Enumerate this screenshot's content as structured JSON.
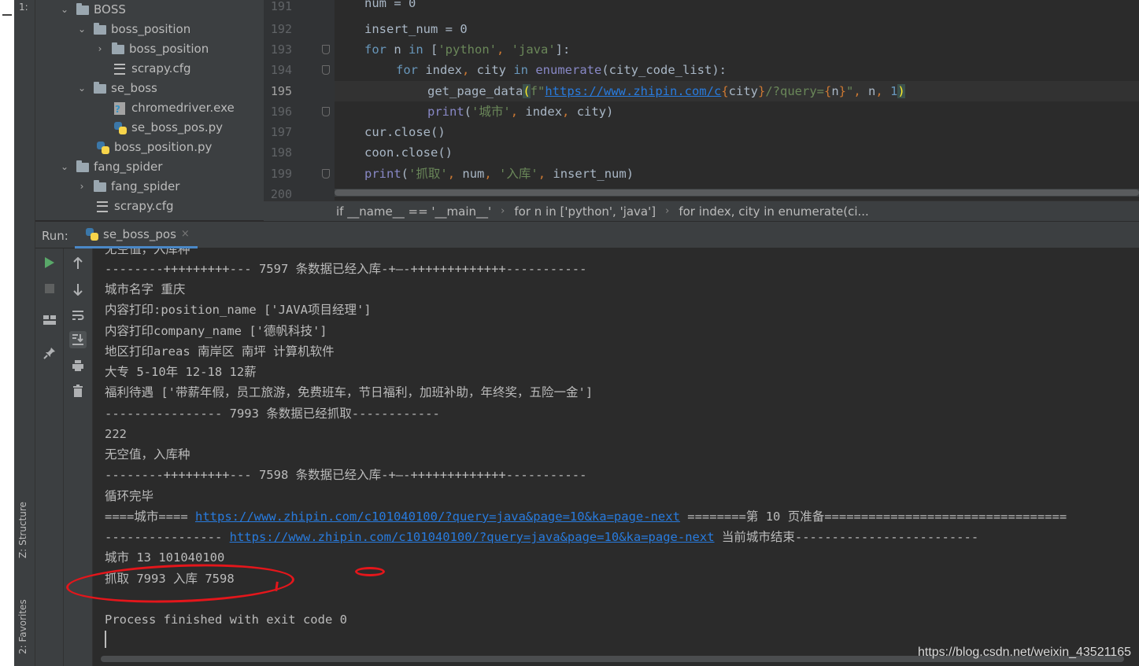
{
  "tool_stripe": {
    "top_item": "1:",
    "structure_tab": "Z: Structure",
    "favorites_tab": "2: Favorites"
  },
  "project_tree": {
    "items": [
      {
        "label": "BOSS",
        "type": "folder",
        "expanded": true
      },
      {
        "label": "boss_position",
        "type": "folder",
        "expanded": true
      },
      {
        "label": "boss_position",
        "type": "folder",
        "expanded": false
      },
      {
        "label": "scrapy.cfg",
        "type": "cfg"
      },
      {
        "label": "se_boss",
        "type": "folder",
        "expanded": true
      },
      {
        "label": "chromedriver.exe",
        "type": "exe"
      },
      {
        "label": "se_boss_pos.py",
        "type": "py"
      },
      {
        "label": "boss_position.py",
        "type": "py"
      },
      {
        "label": "fang_spider",
        "type": "folder",
        "expanded": true
      },
      {
        "label": "fang_spider",
        "type": "folder",
        "expanded": false
      },
      {
        "label": "scrapy.cfg",
        "type": "cfg"
      }
    ]
  },
  "editor": {
    "line_numbers": [
      "191",
      "192",
      "193",
      "194",
      "195",
      "196",
      "197",
      "198",
      "199",
      "200"
    ],
    "current_line": "195",
    "lines": {
      "l191": "num = 0",
      "l192": "insert_num = 0",
      "l193_for": "for",
      "l193_n": " n ",
      "l193_in": "in",
      "l193_list_open": " [",
      "l193_s1": "'python'",
      "l193_comma": ", ",
      "l193_s2": "'java'",
      "l193_close": "]:",
      "l194_for": "for",
      "l194_vars": " index",
      "l194_c": ",",
      "l194_city": " city ",
      "l194_in": "in",
      "l194_enum": " enumerate",
      "l194_rest": "(city_code_list):",
      "l195_fn": "get_page_data",
      "l195_paren": "(",
      "l195_f": "f\"",
      "l195_url": "https://www.zhipin.com/c",
      "l195_b1": "{",
      "l195_city": "city",
      "l195_b2": "}",
      "l195_mid": "/?query=",
      "l195_b3": "{",
      "l195_n": "n",
      "l195_b4": "}",
      "l195_q": "\"",
      "l195_c1": ",",
      "l195_narg": " n",
      "l195_c2": ",",
      "l195_one": " 1",
      "l195_end": ")",
      "l196_print": "print",
      "l196_open": "(",
      "l196_s": "'城市'",
      "l196_c1": ",",
      "l196_index": " index",
      "l196_c2": ",",
      "l196_rest": " city)",
      "l197": "cur.close()",
      "l198": "coon.close()",
      "l199_print": "print",
      "l199_open": "(",
      "l199_s1": "'抓取'",
      "l199_c1": ",",
      "l199_num": " num",
      "l199_c2": ",",
      "l199_s2": " '入库'",
      "l199_c3": ",",
      "l199_rest": " insert_num)"
    }
  },
  "breadcrumb": {
    "items": [
      "if __name__ == '__main__'",
      "for n in ['python', 'java']",
      "for index, city in enumerate(ci..."
    ]
  },
  "run_panel": {
    "label": "Run:",
    "tab_name": "se_boss_pos",
    "close_glyph": "×"
  },
  "console": {
    "lines": [
      "无空值，入库种",
      "--------+++++++++--- 7597 条数据已经入库-+—-+++++++++++++-----------",
      "城市名字 重庆",
      "内容打印:position_name ['JAVA项目经理']",
      "内容打印company_name ['德帆科技']",
      "地区打印areas 南岸区 南坪 计算机软件",
      "大专 5-10年 12-18 12薪",
      "福利待遇 ['带薪年假，员工旅游，免费班车，节日福利，加班补助，年终奖，五险一金']",
      "---------------- 7993 条数据已经抓取------------",
      "222",
      "无空值，入库种",
      "--------+++++++++--- 7598 条数据已经入库-+—-+++++++++++++-----------"
    ],
    "loop_done": "循环完毕",
    "city_line_prefix": "====城市==== ",
    "city_line_link": "https://www.zhipin.com/c101040100/?query=java&page=10&ka=page-next",
    "city_line_suffix": " ========第 10 页准备=================================",
    "end_line_prefix": "---------------- ",
    "end_line_link": "https://www.zhipin.com/c101040100/?query=java&page=10&ka=page-next",
    "end_line_suffix": " 当前城市结束-------------------------",
    "city_count": "城市 13 101040100",
    "summary": "抓取 7993 入库 7598",
    "process": "Process finished with exit code 0"
  },
  "watermark": "https://blog.csdn.net/weixin_43521165",
  "colors": {
    "editor_bg": "#2b2b2b",
    "panel_bg": "#3c3f41",
    "keyword": "#cc7832",
    "string": "#6a8759",
    "number": "#6897bb",
    "link": "#287bde",
    "annotation_red": "#e4161b",
    "run_icon_green": "#59a869"
  }
}
